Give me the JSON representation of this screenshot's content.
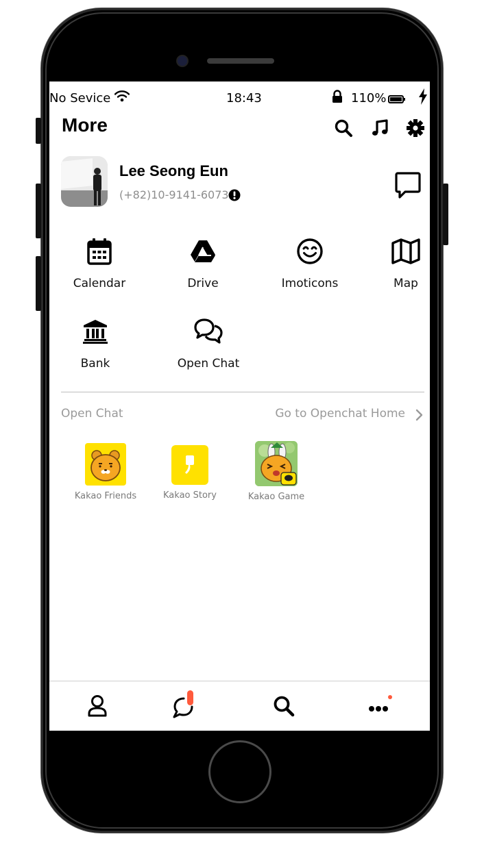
{
  "status_bar": {
    "carrier": "No Sevice",
    "time": "18:43",
    "battery": "110%"
  },
  "header": {
    "title": "More",
    "icons": [
      "search-icon",
      "music-icon",
      "gear-icon"
    ]
  },
  "profile": {
    "name": "Lee Seong Eun",
    "phone": "(+82)10-9141-6073"
  },
  "menu": [
    {
      "label": "Calendar",
      "icon": "calendar-icon"
    },
    {
      "label": "Drive",
      "icon": "drive-icon"
    },
    {
      "label": "Imoticons",
      "icon": "smile-icon"
    },
    {
      "label": "Map",
      "icon": "map-icon"
    },
    {
      "label": "Bank",
      "icon": "bank-icon"
    },
    {
      "label": "Open Chat",
      "icon": "open-chat-icon"
    }
  ],
  "open_chat": {
    "title": "Open Chat",
    "link": "Go to Openchat Home",
    "apps": [
      {
        "label": "Kakao Friends",
        "icon": "kakao-friends-icon"
      },
      {
        "label": "Kakao Story",
        "icon": "kakao-story-icon"
      },
      {
        "label": "Kakao Game",
        "icon": "kakao-game-icon"
      }
    ]
  },
  "tab_bar": {
    "tabs": [
      "friends-tab",
      "chats-tab",
      "search-tab",
      "more-tab"
    ]
  },
  "colors": {
    "kakao_yellow": "#FFE100",
    "badge": "#FF5A3C",
    "muted_text": "#9A9A9A"
  }
}
